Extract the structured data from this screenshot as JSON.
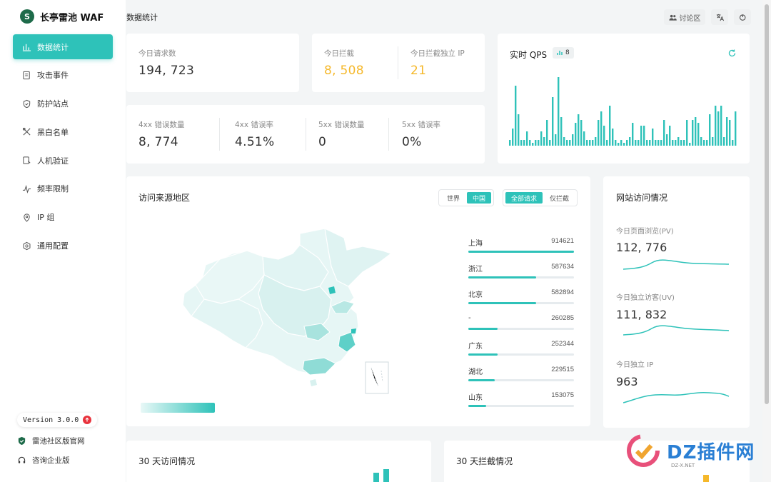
{
  "app": {
    "name": "长亭雷池 WAF",
    "logo_text": "S"
  },
  "sidebar": {
    "items": [
      {
        "label": "数据统计",
        "icon": "bar-chart-icon",
        "active": true
      },
      {
        "label": "攻击事件",
        "icon": "document-icon",
        "active": false
      },
      {
        "label": "防护站点",
        "icon": "shield-icon",
        "active": false
      },
      {
        "label": "黑白名单",
        "icon": "tools-icon",
        "active": false
      },
      {
        "label": "人机验证",
        "icon": "verify-icon",
        "active": false
      },
      {
        "label": "频率限制",
        "icon": "pulse-icon",
        "active": false
      },
      {
        "label": "IP 组",
        "icon": "location-icon",
        "active": false
      },
      {
        "label": "通用配置",
        "icon": "gear-icon",
        "active": false
      }
    ],
    "version": "Version 3.0.0",
    "links": [
      {
        "label": "雷池社区版官网",
        "icon": "shield-logo-icon"
      },
      {
        "label": "咨询企业版",
        "icon": "headset-icon"
      }
    ]
  },
  "header": {
    "title": "数据统计",
    "forum_label": "讨论区",
    "lang_icon": "translate-icon",
    "logout_icon": "logout-icon"
  },
  "stats": {
    "requests": {
      "label": "今日请求数",
      "value": "194, 723"
    },
    "blocked": {
      "label": "今日拦截",
      "value": "8, 508"
    },
    "blocked_ip": {
      "label": "今日拦截独立 IP",
      "value": "21"
    },
    "err4xx": {
      "label": "4xx 错误数量",
      "value": "8, 774"
    },
    "err4xx_rate": {
      "label": "4xx 错误率",
      "value": "4.51%"
    },
    "err5xx": {
      "label": "5xx 错误数量",
      "value": "0"
    },
    "err5xx_rate": {
      "label": "5xx 错误率",
      "value": "0%"
    }
  },
  "qps": {
    "title": "实时 QPS",
    "badge": "8",
    "refresh_icon": "refresh-icon",
    "bars": [
      2,
      6,
      21,
      11,
      2,
      2,
      5,
      2,
      1,
      2,
      2,
      5,
      3,
      9,
      2,
      17,
      4,
      24,
      10,
      3,
      2,
      2,
      4,
      8,
      11,
      9,
      5,
      2,
      2,
      2,
      3,
      9,
      12,
      7,
      2,
      14,
      6,
      2,
      1,
      2,
      1,
      2,
      3,
      8,
      2,
      2,
      7,
      7,
      2,
      2,
      6,
      2,
      2,
      2,
      9,
      4,
      7,
      2,
      2,
      3,
      2,
      2,
      9,
      1,
      9,
      10,
      8,
      3,
      2,
      2,
      11,
      3,
      14,
      12,
      14,
      3,
      10,
      9,
      2,
      12
    ]
  },
  "region": {
    "title": "访问来源地区",
    "scope_options": [
      "世界",
      "中国"
    ],
    "scope_selected": "中国",
    "filter_options": [
      "全部请求",
      "仅拦截"
    ],
    "filter_selected": "全部请求",
    "rows": [
      {
        "name": "上海",
        "count": "914621",
        "ratio": 1.0
      },
      {
        "name": "浙江",
        "count": "587634",
        "ratio": 0.64
      },
      {
        "name": "北京",
        "count": "582894",
        "ratio": 0.64
      },
      {
        "name": "-",
        "count": "260285",
        "ratio": 0.28
      },
      {
        "name": "广东",
        "count": "252344",
        "ratio": 0.28
      },
      {
        "name": "湖北",
        "count": "229515",
        "ratio": 0.25
      },
      {
        "name": "山东",
        "count": "153075",
        "ratio": 0.17
      }
    ]
  },
  "site": {
    "title": "网站访问情况",
    "pv": {
      "label": "今日页面浏览(PV)",
      "value": "112, 776"
    },
    "uv": {
      "label": "今日独立访客(UV)",
      "value": "111, 832"
    },
    "ip": {
      "label": "今日独立 IP",
      "value": "963"
    }
  },
  "bottom": {
    "visits_title": "30 天访问情况",
    "blocks_title": "30 天拦截情况"
  },
  "watermark": {
    "text": "DZ插件网",
    "sub": "DZ-X.NET"
  },
  "colors": {
    "accent": "#2ec2b9",
    "warn": "#f5b82b"
  }
}
